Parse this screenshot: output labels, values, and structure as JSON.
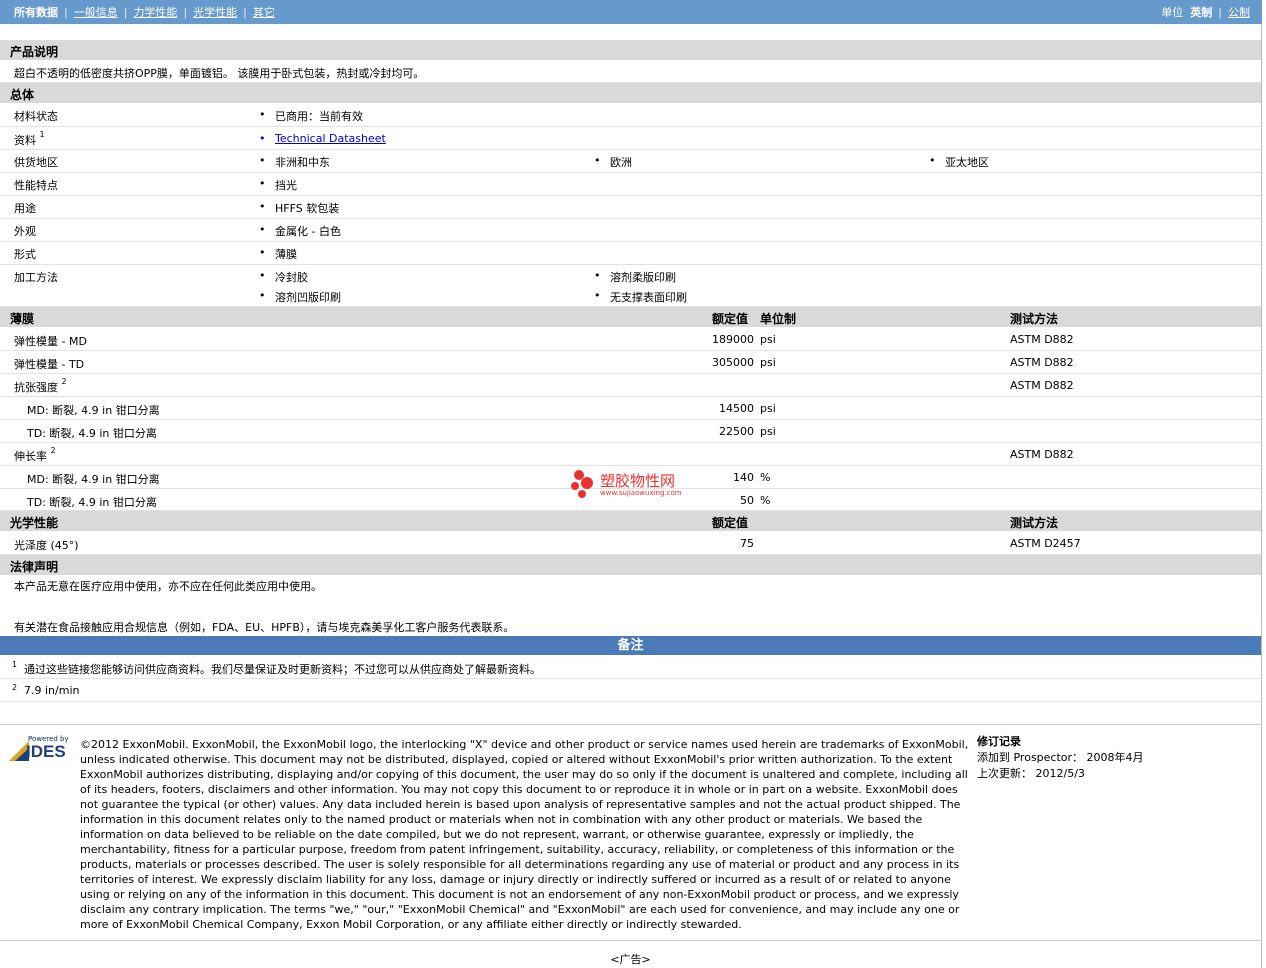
{
  "nav": {
    "tabs": [
      "所有数据",
      "一般信息",
      "力学性能",
      "光学性能",
      "其它"
    ],
    "units_label": "单位",
    "unit_english": "英制",
    "unit_metric": "公制"
  },
  "product": {
    "heading": "产品说明",
    "description": "超白不透明的低密度共挤OPP膜，单面镀铝。 该膜用于卧式包装，热封或冷封均可。"
  },
  "general": {
    "heading": "总体",
    "rows": [
      {
        "label": "材料状态",
        "values": [
          "已商用：当前有效"
        ]
      },
      {
        "label": "资料",
        "sup": "1",
        "values": [
          "Technical Datasheet"
        ]
      },
      {
        "label": "供货地区",
        "values": [
          "非洲和中东",
          "欧洲",
          "亚太地区"
        ]
      },
      {
        "label": "性能特点",
        "values": [
          "挡光"
        ]
      },
      {
        "label": "用途",
        "values": [
          "HFFS 软包装"
        ]
      },
      {
        "label": "外观",
        "values": [
          "金属化 - 白色"
        ]
      },
      {
        "label": "形式",
        "values": [
          "薄膜"
        ]
      },
      {
        "label": "加工方法",
        "values": [
          "冷封胶",
          "溶剂柔版印刷",
          "溶剂凹版印刷",
          "无支撑表面印刷"
        ]
      }
    ]
  },
  "film": {
    "heading": "薄膜",
    "col_nominal": "额定值",
    "col_unit": "单位制",
    "col_method": "测试方法",
    "rows": [
      {
        "label": "弹性模量 - MD",
        "value": "189000",
        "unit": "psi",
        "method": "ASTM D882"
      },
      {
        "label": "弹性模量 - TD",
        "value": "305000",
        "unit": "psi",
        "method": "ASTM D882"
      },
      {
        "label": "抗张强度",
        "sup": "2",
        "value": "",
        "unit": "",
        "method": "ASTM D882"
      },
      {
        "label": "MD: 断裂, 4.9 in 钳口分离",
        "value": "14500",
        "unit": "psi",
        "method": ""
      },
      {
        "label": "TD: 断裂, 4.9 in 钳口分离",
        "value": "22500",
        "unit": "psi",
        "method": ""
      },
      {
        "label": "伸长率",
        "sup": "2",
        "value": "",
        "unit": "",
        "method": "ASTM D882"
      },
      {
        "label": "MD: 断裂, 4.9 in 钳口分离",
        "value": "140",
        "unit": "%",
        "method": ""
      },
      {
        "label": "TD: 断裂, 4.9 in 钳口分离",
        "value": "50",
        "unit": "%",
        "method": ""
      }
    ]
  },
  "optical": {
    "heading": "光学性能",
    "col_nominal": "额定值",
    "col_method": "测试方法",
    "rows": [
      {
        "label": "光泽度 (45°)",
        "value": "75",
        "method": "ASTM D2457"
      }
    ]
  },
  "legal_notice": {
    "heading": "法律声明",
    "line1": "本产品无意在医疗应用中使用，亦不应在任何此类应用中使用。",
    "line2": "有关潜在食品接触应用合规信息（例如，FDA、EU、HPFB），请与埃克森美孚化工客户服务代表联系。"
  },
  "notes": {
    "heading": "备注",
    "items": [
      {
        "num": "1",
        "text": "通过这些链接您能够访问供应商资料。我们尽量保证及时更新资料；不过您可以从供应商处了解最新资料。"
      },
      {
        "num": "2",
        "text": "7.9 in/min"
      }
    ]
  },
  "footer": {
    "logo_powered": "Powered by",
    "logo_name": "IDES",
    "copyright": "©2012 ExxonMobil. ExxonMobil, the ExxonMobil logo, the interlocking \"X\" device and other product or service names used herein are trademarks of ExxonMobil, unless indicated otherwise. This document may not be distributed, displayed, copied or altered without ExxonMobil's prior written authorization. To the extent ExxonMobil authorizes distributing, displaying and/or copying of this document, the user may do so only if the document is unaltered and complete, including all of its headers, footers, disclaimers and other information. You may not copy this document to or reproduce it in whole or in part on a website. ExxonMobil does not guarantee the typical (or other) values. Any data included herein is based upon analysis of representative samples and not the actual product shipped. The information in this document relates only to the named product or materials when not in combination with any other product or materials. We based the information on data believed to be reliable on the date compiled, but we do not represent, warrant, or otherwise guarantee, expressly or impliedly, the merchantability, fitness for a particular purpose, freedom from patent infringement, suitability, accuracy, reliability, or completeness of this information or the products, materials or processes described. The user is solely responsible for all determinations regarding any use of material or product and any process in its territories of interest. We expressly disclaim liability for any loss, damage or injury directly or indirectly suffered or incurred as a result of or related to anyone using or relying on any of the information in this document. This document is not an endorsement of any non-ExxonMobil product or process, and we expressly disclaim any contrary implication. The terms \"we,\" \"our,\" \"ExxonMobil Chemical\" and \"ExxonMobil\" are each used for convenience, and may include any one or more of ExxonMobil Chemical Company, Exxon Mobil Corporation, or any affiliate either directly or indirectly stewarded.",
    "revision_heading": "修订记录",
    "added_label": "添加到 Prospector：",
    "added_value": "2008年4月",
    "updated_label": "上次更新：",
    "updated_value": "2012/5/3",
    "ad": "<广告>"
  },
  "watermark": {
    "name": "塑胶物性网",
    "url": "www.sujiaowuxing.com"
  },
  "colors": {
    "nav_bar": "#6699cc",
    "notes_bar": "#4a7ab7",
    "section_bg": "#d9d9d9",
    "link": "#0000cc",
    "watermark_red": "#e8322f"
  }
}
